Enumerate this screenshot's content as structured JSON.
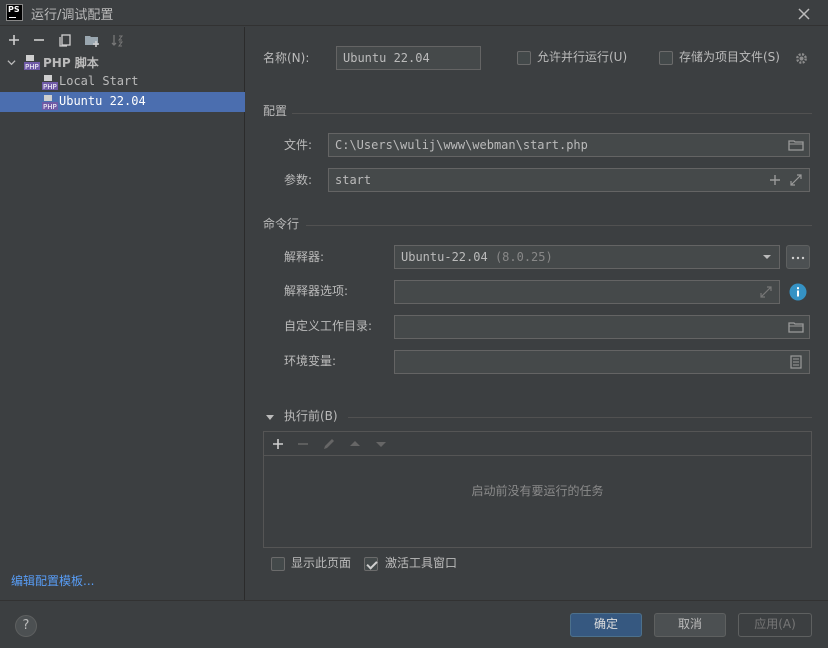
{
  "window": {
    "title": "运行/调试配置",
    "logo": "PS"
  },
  "left_toolbar": {
    "icons": [
      "add-icon",
      "remove-icon",
      "copy-icon",
      "new-folder-icon",
      "sort-icon"
    ]
  },
  "tree": {
    "group": {
      "label": "PHP 脚本",
      "icon": "php-script-icon"
    },
    "items": [
      {
        "label": "Local Start",
        "icon": "php-script-icon"
      },
      {
        "label": "Ubuntu 22.04",
        "icon": "php-script-icon",
        "selected": true
      }
    ]
  },
  "edit_templates_link": "编辑配置模板...",
  "name_field": {
    "label": "名称(N):",
    "value": "Ubuntu 22.04"
  },
  "allow_parallel": {
    "label": "允许并行运行(U)",
    "checked": false
  },
  "store_as_file": {
    "label": "存储为项目文件(S)",
    "checked": false
  },
  "config_section": {
    "title": "配置",
    "file": {
      "label": "文件:",
      "value": "C:\\Users\\wulij\\www\\webman\\start.php"
    },
    "args": {
      "label": "参数:",
      "value": "start"
    }
  },
  "cmdline_section": {
    "title": "命令行",
    "interpreter": {
      "label": "解释器:",
      "value": "Ubuntu-22.04",
      "version": "(8.0.25)"
    },
    "interpreter_options": {
      "label": "解释器选项:",
      "value": ""
    },
    "working_dir": {
      "label": "自定义工作目录:",
      "value": ""
    },
    "env_vars": {
      "label": "环境变量:",
      "value": ""
    }
  },
  "before_launch": {
    "title": "执行前(B)",
    "empty_text": "启动前没有要运行的任务",
    "toolbar_icons": [
      "add-icon",
      "remove-icon",
      "edit-icon",
      "move-up-icon",
      "move-down-icon"
    ]
  },
  "show_page": {
    "label": "显示此页面",
    "checked": false
  },
  "activate_tool_window": {
    "label": "激活工具窗口",
    "checked": true
  },
  "buttons": {
    "ok": "确定",
    "cancel": "取消",
    "apply": "应用(A)",
    "help": "?"
  },
  "colors": {
    "background": "#3c3f41",
    "selection": "#4b6eaf",
    "link": "#589df6",
    "primary_button": "#365880",
    "info_icon": "#3592c4"
  }
}
